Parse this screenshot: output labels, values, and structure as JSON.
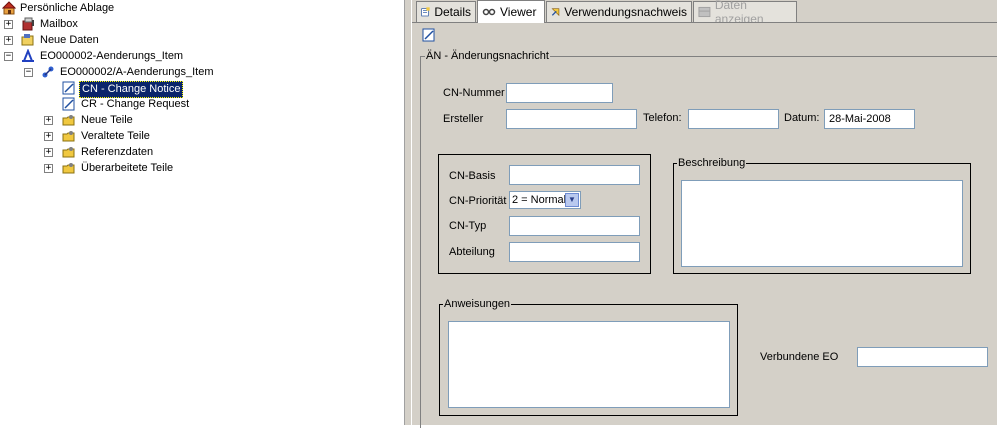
{
  "tree": {
    "items": [
      {
        "label": "Persönliche Ablage",
        "icon": "home-folder-icon"
      },
      {
        "label": "Mailbox",
        "icon": "mailbox-icon",
        "expander": "+"
      },
      {
        "label": "Neue Daten",
        "icon": "folder-icon",
        "expander": "+"
      },
      {
        "label": "EO000002-Aenderungs_Item",
        "icon": "change-item-icon",
        "expander": "−"
      },
      {
        "label": "EO000002/A-Aenderungs_Item",
        "icon": "revision-icon",
        "expander": "−"
      },
      {
        "label": "CN - Change Notice",
        "icon": "form-icon",
        "selected": true
      },
      {
        "label": "CR - Change Request",
        "icon": "form-icon"
      },
      {
        "label": "Neue Teile",
        "icon": "pseudo-folder-icon",
        "expander": "+"
      },
      {
        "label": "Veraltete Teile",
        "icon": "pseudo-folder-icon",
        "expander": "+"
      },
      {
        "label": "Referenzdaten",
        "icon": "pseudo-folder-icon",
        "expander": "+"
      },
      {
        "label": "Überarbeitete Teile",
        "icon": "pseudo-folder-icon",
        "expander": "+"
      }
    ]
  },
  "tabs": [
    {
      "label": "Details",
      "icon": "details-icon",
      "state": "normal"
    },
    {
      "label": "Viewer",
      "icon": "viewer-icon",
      "state": "active"
    },
    {
      "label": "Verwendungsnachweis",
      "icon": "where-used-icon",
      "state": "normal"
    },
    {
      "label": "Daten anzeigen",
      "icon": "show-data-icon",
      "state": "disabled"
    }
  ],
  "form": {
    "main_group_title": "ÄN - Änderungsnachricht",
    "cn_nummer_label": "CN-Nummer",
    "cn_nummer_value": "",
    "ersteller_label": "Ersteller",
    "ersteller_value": "",
    "telefon_label": "Telefon:",
    "telefon_value": "",
    "datum_label": "Datum:",
    "datum_value": "28-Mai-2008",
    "cn_basis_label": "CN-Basis",
    "cn_basis_value": "",
    "cn_prioritaet_label": "CN-Priorität",
    "cn_prioritaet_value": "2 = Normal",
    "cn_typ_label": "CN-Typ",
    "cn_typ_value": "",
    "abteilung_label": "Abteilung",
    "abteilung_value": "",
    "beschreibung_title": "Beschreibung",
    "anweisungen_title": "Anweisungen",
    "verbundene_eo_label": "Verbundene EO",
    "verbundene_eo_value": ""
  },
  "colors": {
    "selection": "#0a246a",
    "panel": "#d4d0c8",
    "field_border": "#7f9db9"
  }
}
